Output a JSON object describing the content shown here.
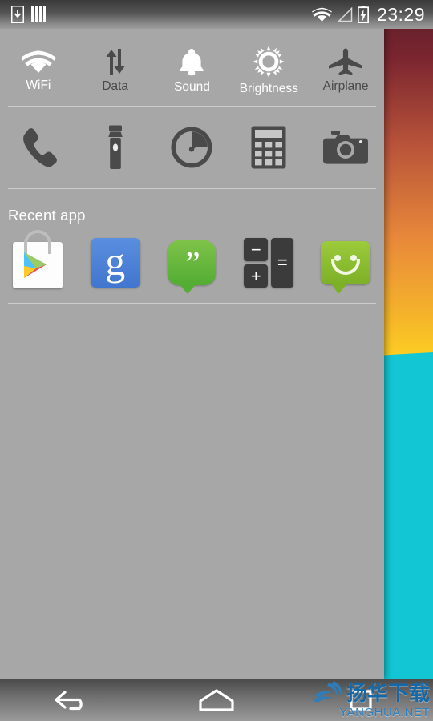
{
  "statusbar": {
    "left_icons": [
      {
        "name": "download-icon",
        "label": "download"
      },
      {
        "name": "bars-icon",
        "label": "bars"
      }
    ],
    "right_icons": [
      {
        "name": "wifi-icon",
        "label": "wifi"
      },
      {
        "name": "signal-icon",
        "label": "signal"
      },
      {
        "name": "battery-charging-icon",
        "label": "battery-charging"
      }
    ],
    "clock": "23:29"
  },
  "quick_toggles": [
    {
      "label": "WiFi",
      "icon": "wifi-icon",
      "state": "on"
    },
    {
      "label": "Data",
      "icon": "data-sync-icon",
      "state": "off"
    },
    {
      "label": "Sound",
      "icon": "bell-icon",
      "state": "on"
    },
    {
      "label": "Brightness",
      "icon": "sun-icon",
      "state": "on"
    },
    {
      "label": "Airplane",
      "icon": "airplane-icon",
      "state": "off"
    }
  ],
  "shortcuts": [
    {
      "icon": "phone-icon",
      "label": "Phone"
    },
    {
      "icon": "flashlight-icon",
      "label": "Flashlight"
    },
    {
      "icon": "timer-icon",
      "label": "Timer"
    },
    {
      "icon": "calculator-icon",
      "label": "Calculator"
    },
    {
      "icon": "camera-icon",
      "label": "Camera"
    }
  ],
  "recent": {
    "title": "Recent app",
    "apps": [
      {
        "icon": "play-store-icon",
        "label": "Play Store"
      },
      {
        "icon": "google-search-icon",
        "label": "Google",
        "glyph": "g"
      },
      {
        "icon": "hangouts-icon",
        "label": "Hangouts",
        "glyph": "”"
      },
      {
        "icon": "calculator-app-icon",
        "label": "Calculator",
        "keys": [
          "−",
          "+",
          "="
        ]
      },
      {
        "icon": "messaging-icon",
        "label": "Messaging"
      }
    ]
  },
  "navbar": [
    {
      "icon": "back-icon",
      "label": "Back"
    },
    {
      "icon": "home-icon",
      "label": "Home"
    },
    {
      "icon": "recents-icon",
      "label": "Recents"
    }
  ],
  "watermark": {
    "cn": "扬华下载",
    "en": "YANGHUA.NET"
  },
  "colors": {
    "panel_bg": "#a7a7a7",
    "toggle_on": "#ffffff",
    "toggle_off": "#4a4a4a",
    "wallpaper_top": "#5a1e26",
    "wallpaper_yellow": "#ffe310",
    "wallpaper_cyan": "#12c6d4",
    "watermark_blue": "#1569a8"
  }
}
